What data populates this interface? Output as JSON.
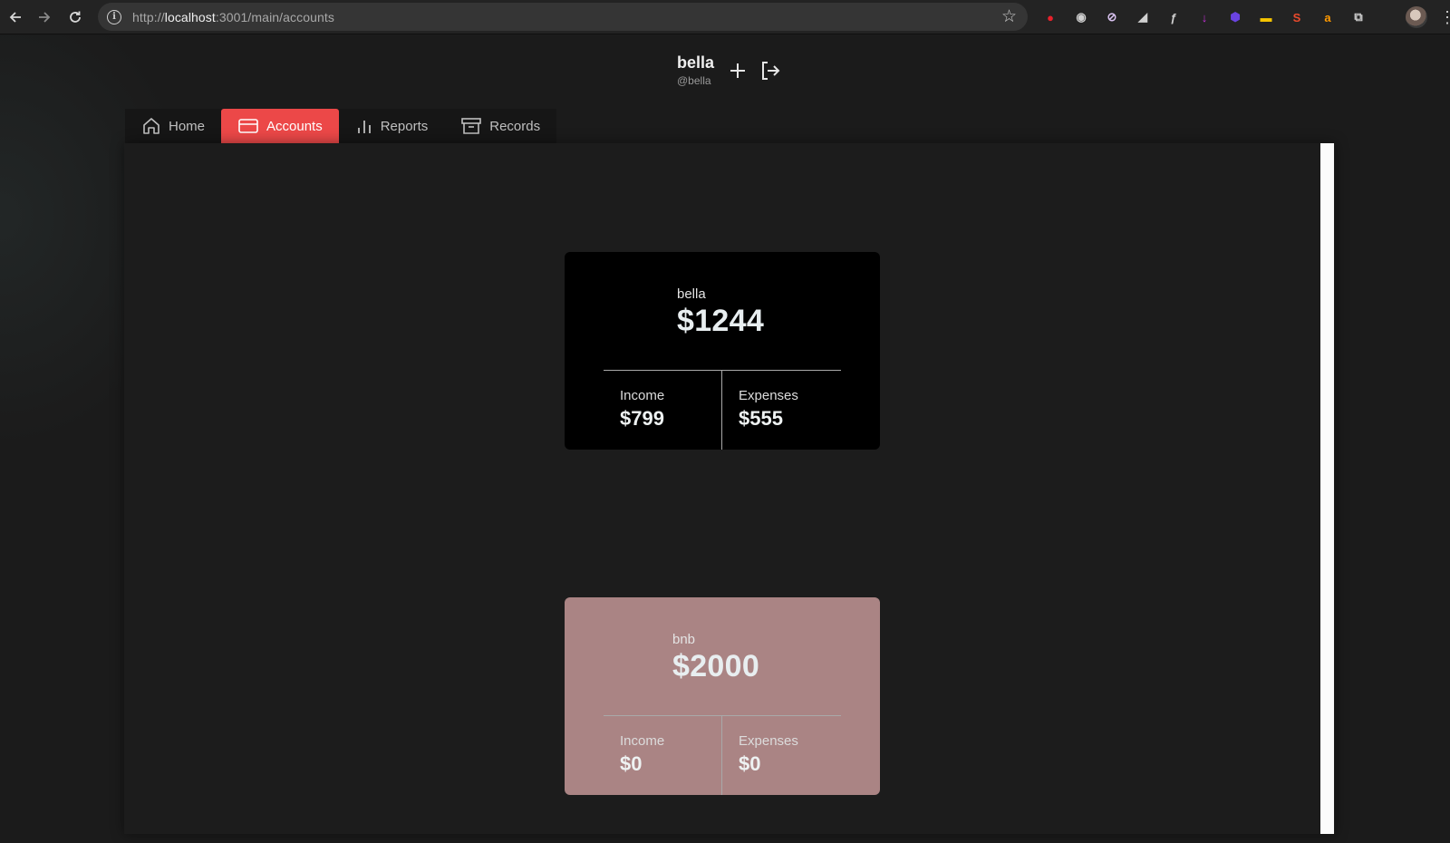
{
  "browser": {
    "url_scheme": "http://",
    "url_host": "localhost",
    "url_rest": ":3001/main/accounts",
    "extensions": [
      {
        "icon": "red-shield-extension-icon",
        "glyph": "●",
        "color": "#e8212b"
      },
      {
        "icon": "camera-extension-icon",
        "glyph": "◉",
        "color": "#d0d0d0"
      },
      {
        "icon": "compass-extension-icon",
        "glyph": "⊘",
        "color": "#d9c2f0"
      },
      {
        "icon": "dark-reader-extension-icon",
        "glyph": "◢",
        "color": "#d0d0d0"
      },
      {
        "icon": "function-extension-icon",
        "glyph": "ƒ",
        "color": "#d0d0d0"
      },
      {
        "icon": "download-extension-icon",
        "glyph": "↓",
        "color": "#c22fd6"
      },
      {
        "icon": "badge-extension-icon",
        "glyph": "⬢",
        "color": "#6a43e0"
      },
      {
        "icon": "notes-extension-icon",
        "glyph": "▬",
        "color": "#f5c400"
      },
      {
        "icon": "s-extension-icon",
        "glyph": "S",
        "color": "#ea4a2c"
      },
      {
        "icon": "amazon-extension-icon",
        "glyph": "a",
        "color": "#ff9900"
      },
      {
        "icon": "puzzle-extensions-icon",
        "glyph": "⧉",
        "color": "#d0d0d0"
      }
    ]
  },
  "header": {
    "display_name": "bella",
    "handle": "@bella"
  },
  "tabs": [
    {
      "label": "Home",
      "icon": "home-icon",
      "active": false
    },
    {
      "label": "Accounts",
      "icon": "credit-card-icon",
      "active": true
    },
    {
      "label": "Reports",
      "icon": "bar-chart-icon",
      "active": false
    },
    {
      "label": "Records",
      "icon": "archive-icon",
      "active": false
    }
  ],
  "accounts": [
    {
      "name": "bella",
      "balance": "$1244",
      "income_label": "Income",
      "income": "$799",
      "expenses_label": "Expenses",
      "expenses": "$555",
      "color": "#000000"
    },
    {
      "name": "bnb",
      "balance": "$2000",
      "income_label": "Income",
      "income": "$0",
      "expenses_label": "Expenses",
      "expenses": "$0",
      "color": "#aa8484"
    }
  ]
}
